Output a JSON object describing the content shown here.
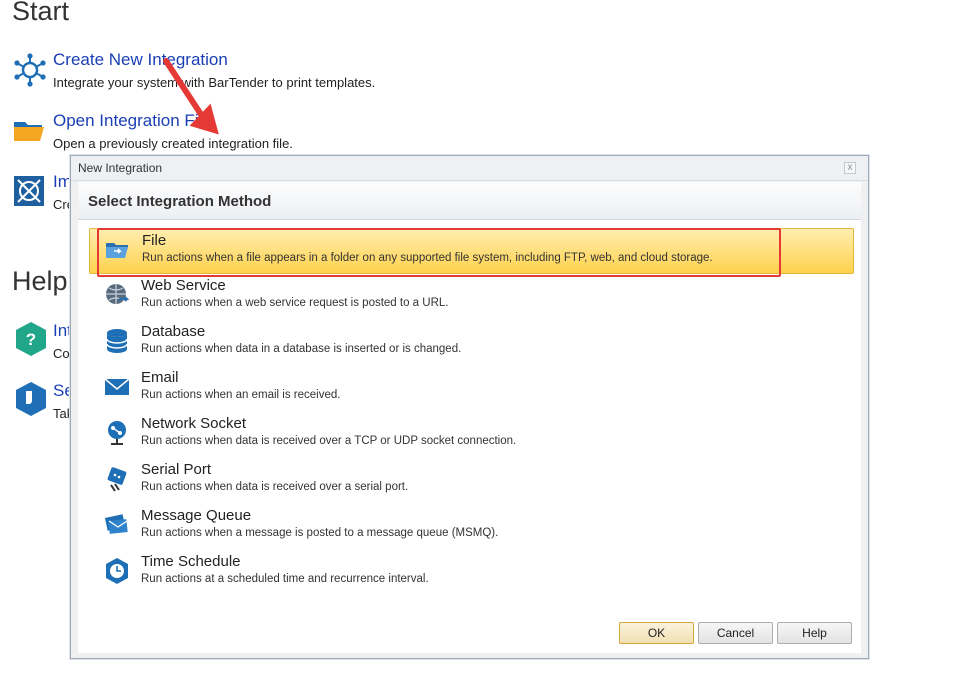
{
  "start_page": {
    "start_heading": "Start",
    "help_heading": "Help",
    "items": [
      {
        "title": "Create New Integration",
        "desc": "Integrate your system with BarTender to print templates."
      },
      {
        "title": "Open Integration File",
        "desc": "Open a previously created integration file."
      },
      {
        "title": "Im",
        "desc": "Cre"
      }
    ],
    "help_items": [
      {
        "title": "Int",
        "desc": "Co"
      },
      {
        "title": "Se",
        "desc": "Tak"
      }
    ]
  },
  "dialog": {
    "title": "New Integration",
    "close_glyph": "x",
    "header": "Select Integration Method",
    "methods": [
      {
        "name": "File",
        "desc": "Run actions when a file appears in a folder on any supported file system, including FTP, web, and cloud storage.",
        "icon": "folder-icon",
        "selected": true
      },
      {
        "name": "Web Service",
        "desc": "Run actions when a web service request is posted to a URL.",
        "icon": "web-service-icon"
      },
      {
        "name": "Database",
        "desc": "Run actions when data in a database is inserted or is changed.",
        "icon": "database-icon"
      },
      {
        "name": "Email",
        "desc": "Run actions when an email is received.",
        "icon": "email-icon"
      },
      {
        "name": "Network Socket",
        "desc": "Run actions when data is received over a TCP or UDP socket connection.",
        "icon": "network-socket-icon"
      },
      {
        "name": "Serial Port",
        "desc": "Run actions when data is received over a serial port.",
        "icon": "serial-port-icon"
      },
      {
        "name": "Message Queue",
        "desc": "Run actions when a message is posted to a message queue (MSMQ).",
        "icon": "message-queue-icon"
      },
      {
        "name": "Time Schedule",
        "desc": "Run actions at a scheduled time and recurrence interval.",
        "icon": "time-schedule-icon"
      }
    ],
    "buttons": {
      "ok": "OK",
      "cancel": "Cancel",
      "help": "Help"
    }
  },
  "colors": {
    "link": "#1a3fb4",
    "selection": "#ffd24d",
    "annotation": "#e53935",
    "icon_blue": "#1e6fb5"
  }
}
